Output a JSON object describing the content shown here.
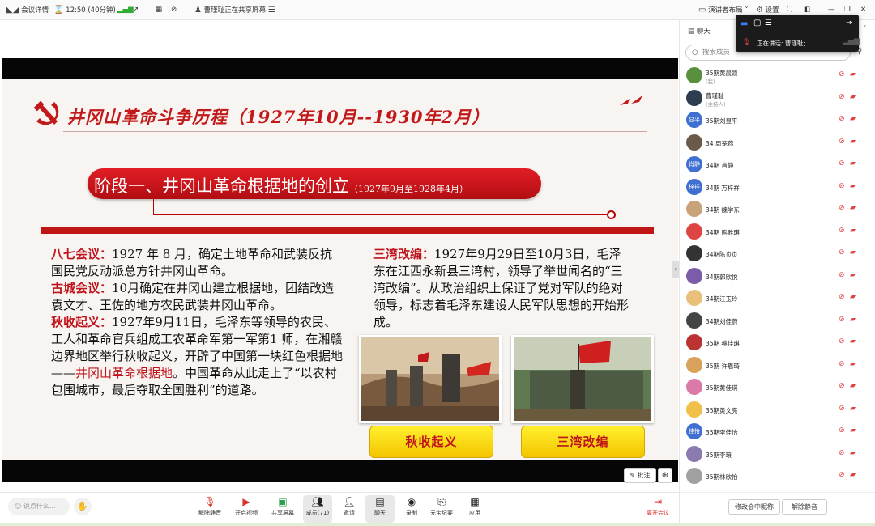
{
  "topbar": {
    "meeting_details": "会议详情",
    "timer": "12:50 (40分钟)",
    "sharing_status": "曹瑾耻正在共享屏幕",
    "layout_label": "演讲者布局",
    "settings_label": "设置"
  },
  "float_panel": {
    "speaking_label": "正在讲话:",
    "speaker_name": "曹瑾耻;"
  },
  "slide": {
    "title": "井冈山革命斗争历程（1927年10月--1930年2月）",
    "stage_title": "阶段一、井冈山革命根据地的创立",
    "stage_date": "（1927年9月至1928年4月）",
    "p1_head": "八七会议：",
    "p1_body": "1927 年 8 月，确定土地革命和武装反抗国民党反动派总方针井冈山革命。",
    "p2_head": "古城会议：",
    "p2_body": "10月确定在井冈山建立根据地，团结改造袁文才、王佐的地方农民武装井冈山革命。",
    "p3_head": "秋收起义：",
    "p3_body": "1927年9月11日，毛泽东等领导的农民、工人和革命官兵组成工农革命军第一军第1 师，在湘赣边界地区举行秋收起义，开辟了中国第一块红色根据地——",
    "p3_red": "井冈山革命根据地",
    "p3_tail": "。中国革命从此走上了“以农村包围城市，最后夺取全国胜利”的道路。",
    "p4_head": "三湾改编：",
    "p4_body": "1927年9月29日至10月3日，毛泽东在江西永新县三湾村，领导了举世闻名的“三湾改编”。从政治组织上保证了党对军队的绝对领导，标志着毛泽东建设人民军队思想的开始形成。",
    "btn1": "秋收起义",
    "btn2": "三湾改编"
  },
  "overlay": {
    "annotate": "批注",
    "zoom": "⊕"
  },
  "bottombar": {
    "chat_placeholder": "说点什么...",
    "items": [
      {
        "label": "解除静音",
        "icon": "mic-off-icon"
      },
      {
        "label": "开启视频",
        "icon": "camera-off-icon"
      },
      {
        "label": "共享屏幕",
        "icon": "share-screen-icon"
      },
      {
        "label": "成员(71)",
        "icon": "members-icon"
      },
      {
        "label": "邀请",
        "icon": "invite-icon"
      },
      {
        "label": "聊天",
        "icon": "chat-icon"
      },
      {
        "label": "录制",
        "icon": "record-icon"
      },
      {
        "label": "元宝纪要",
        "icon": "minutes-icon"
      },
      {
        "label": "应用",
        "icon": "apps-icon"
      },
      {
        "label": "离开会议",
        "icon": "leave-icon"
      }
    ]
  },
  "sidebar": {
    "chat_tab": "聊天",
    "search_placeholder": "搜索成员",
    "members": [
      {
        "name": "35期黄晨颖",
        "tag": "(我)",
        "avatar": "",
        "color": "#5a8f3d"
      },
      {
        "name": "曹瑾耻",
        "tag": "(主持人)",
        "avatar": "",
        "color": "#2c3e50"
      },
      {
        "name": "35期刘显平",
        "tag": "",
        "avatar": "显平",
        "color": "#3f6fd1"
      },
      {
        "name": "34 周笼燕",
        "tag": "",
        "avatar": "",
        "color": "#6b5a4a"
      },
      {
        "name": "34期 肖静",
        "tag": "",
        "avatar": "肖静",
        "color": "#3f6fd1"
      },
      {
        "name": "34期 万梓祥",
        "tag": "",
        "avatar": "梓祥",
        "color": "#3f6fd1"
      },
      {
        "name": "34期 魏学东",
        "tag": "",
        "avatar": "",
        "color": "#c9a27a"
      },
      {
        "name": "34期 熊雅琪",
        "tag": "",
        "avatar": "",
        "color": "#d44"
      },
      {
        "name": "34期陈贞贞",
        "tag": "",
        "avatar": "",
        "color": "#333"
      },
      {
        "name": "34期郭欣悦",
        "tag": "",
        "avatar": "",
        "color": "#7a5ca8"
      },
      {
        "name": "34期汪玉玲",
        "tag": "",
        "avatar": "",
        "color": "#e8c07a"
      },
      {
        "name": "34期刘佳蔚",
        "tag": "",
        "avatar": "",
        "color": "#444"
      },
      {
        "name": "35期 蔡佳琪",
        "tag": "",
        "avatar": "",
        "color": "#b33"
      },
      {
        "name": "35期 许恩琦",
        "tag": "",
        "avatar": "",
        "color": "#d9a15a"
      },
      {
        "name": "35期黄佳琪",
        "tag": "",
        "avatar": "",
        "color": "#d97aa8"
      },
      {
        "name": "35期黄文亮",
        "tag": "",
        "avatar": "",
        "color": "#f0c04a"
      },
      {
        "name": "35期李佳怡",
        "tag": "",
        "avatar": "佳怡",
        "color": "#3f6fd1"
      },
      {
        "name": "35期李琅",
        "tag": "",
        "avatar": "",
        "color": "#8a7ab0"
      },
      {
        "name": "35期林欣怡",
        "tag": "",
        "avatar": "",
        "color": "#a0a0a0"
      }
    ],
    "btn_rename": "修改会中昵称",
    "btn_unmute": "解除静音"
  }
}
